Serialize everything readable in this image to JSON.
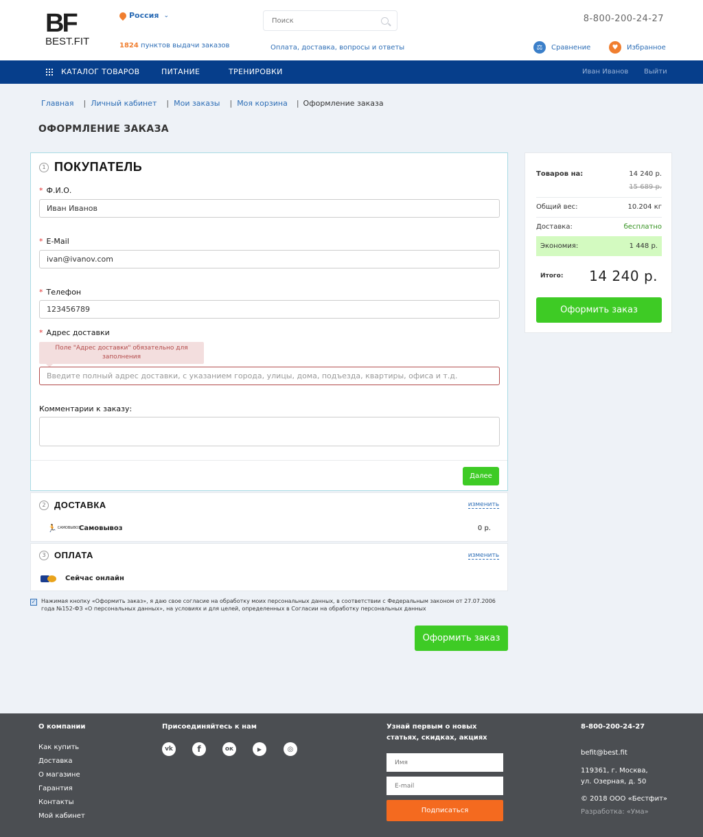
{
  "header": {
    "logo_mark": "BF",
    "logo_text": "BEST.FIT",
    "region": "Россия",
    "pickups_count": "1824",
    "pickups_text": "пунктов выдачи заказов",
    "search_placeholder": "Поиск",
    "faq_link": "Оплата, доставка, вопросы и ответы",
    "phone": "8-800-200-24-27",
    "compare_label": "Сравнение",
    "favorites_label": "Избранное"
  },
  "nav": {
    "items": [
      "КАТАЛОГ ТОВАРОВ",
      "ПИТАНИЕ",
      "ТРЕНИРОВКИ"
    ],
    "user_name": "Иван Иванов",
    "logout": "Выйти"
  },
  "breadcrumb": [
    "Главная",
    "Личный кабинет",
    "Мои заказы",
    "Моя корзина",
    "Оформление заказа"
  ],
  "page_title": "ОФОРМЛЕНИЕ ЗАКАЗА",
  "buyer": {
    "step": "1",
    "title": "ПОКУПАТЕЛЬ",
    "fio_label": "Ф.И.О.",
    "fio_value": "Иван Иванов",
    "email_label": "E-Mail",
    "email_value": "ivan@ivanov.com",
    "phone_label": "Телефон",
    "phone_value": "123456789",
    "address_label": "Адрес доставки",
    "address_error": "Поле \"Адрес доставки\" обязательно для заполнения",
    "address_placeholder": "Введите полный адрес доставки, с указанием города, улицы, дома, подъезда, квартиры, офиса и т.д.",
    "comment_label": "Комментарии к заказу:",
    "next_button": "Далее"
  },
  "delivery": {
    "step": "2",
    "title": "ДОСТАВКА",
    "change": "изменить",
    "method": "Самовывоз",
    "price": "0 р."
  },
  "payment": {
    "step": "3",
    "title": "ОПЛАТА",
    "change": "изменить",
    "method": "Сейчас онлайн"
  },
  "consent_text": "Нажимая кнопку «Оформить заказ», я даю свое согласие на обработку моих персональных данных, в соответствии с Федеральным законом от 27.07.2006 года №152-ФЗ «О персональных данных», на условиях и для целей, определенных в Согласии на обработку персональных данных",
  "order_button": "Оформить заказ",
  "summary": {
    "goods_label": "Товаров на:",
    "goods_value": "14 240 р.",
    "goods_old": "15 689 р.",
    "weight_label": "Общий вес:",
    "weight_value": "10.204 кг",
    "delivery_label": "Доставка:",
    "delivery_value": "бесплатно",
    "economy_label": "Экономия:",
    "economy_value": "1 448 р.",
    "total_label": "Итого:",
    "total_value": "14 240 р.",
    "order_button": "Оформить заказ"
  },
  "footer": {
    "about_title": "О компании",
    "about_links": [
      "Как купить",
      "Доставка",
      "О магазине",
      "Гарантия",
      "Контакты",
      "Мой кабинет"
    ],
    "join_title": "Присоединяйтесь к нам",
    "social": [
      "vk-icon",
      "facebook-icon",
      "odnoklassniki-icon",
      "youtube-icon",
      "instagram-icon"
    ],
    "news_title_1": "Узнай первым о новых",
    "news_title_2": "статьях, скидках, акциях",
    "name_placeholder": "Имя",
    "email_placeholder": "E-mail",
    "subscribe_button": "Подписаться",
    "phone": "8-800-200-24-27",
    "email": "befit@best.fit",
    "address_1": "119361, г. Москва,",
    "address_2": "ул. Озерная, д. 50",
    "copyright": "© 2018 ООО «Бестфит»",
    "dev": "Разработка: «Ума»"
  },
  "colors": {
    "nav_bg": "#063e8b",
    "accent_green": "#3ecb25",
    "accent_orange": "#f46a1f",
    "link_blue": "#2b6cb5",
    "footer_bg": "#4b4e52"
  }
}
